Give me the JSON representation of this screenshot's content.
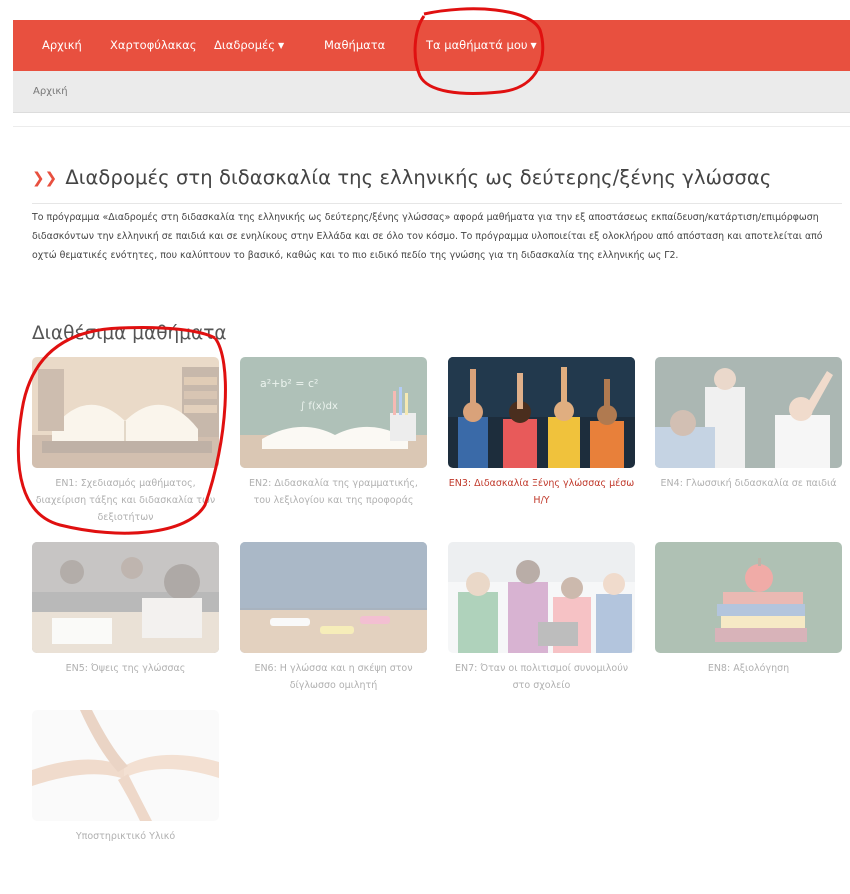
{
  "nav": {
    "items": [
      {
        "label": "Αρχική"
      },
      {
        "label": "Χαρτοφύλακας"
      },
      {
        "label": "Διαδρομές",
        "dropdown": true
      },
      {
        "label": "Μαθήματα"
      },
      {
        "label": "Τα μαθήματά μου",
        "dropdown": true
      }
    ],
    "caret": "▼"
  },
  "breadcrumb": {
    "label": "Αρχική"
  },
  "page": {
    "chevron": "❯❯",
    "title": "Διαδρομές στη διδασκαλία της ελληνικής ως δεύτερης/ξένης γλώσσας",
    "description": "Το πρόγραμμα «Διαδρομές στη διδασκαλία της ελληνικής ως δεύτερης/ξένης γλώσσας» αφορά μαθήματα για την εξ αποστάσεως εκπαίδευση/κατάρτιση/επιμόρφωση διδασκόντων την ελληνική σε παιδιά και σε ενηλίκους στην Ελλάδα και σε όλο τον κόσμο. Το πρόγραμμα υλοποιείται εξ ολοκλήρου από απόσταση και αποτελείται από οχτώ θεματικές ενότητες, που καλύπτουν το βασικό, καθώς και το πιο ειδικό πεδίο της γνώσης για τη διδασκαλία της ελληνικής ως Γ2.",
    "section_title": "Διαθέσιμα μαθήματα"
  },
  "courses": [
    {
      "label": "ΕΝ1: Σχεδιασμός μαθήματος, διαχείριση τάξης και διδασκαλία των δεξιοτήτων",
      "image": "books-on-table",
      "active": false
    },
    {
      "label": "ΕΝ2: Διδασκαλία της γραμματικής, του λεξιλογίου και της προφοράς",
      "image": "book-and-chalkboard",
      "active": false
    },
    {
      "label": "ΕΝ3: Διδασκαλία Ξένης γλώσσας μέσω Η/Υ",
      "image": "raised-hands-classroom",
      "active": true
    },
    {
      "label": "ΕΝ4: Γλωσσική διδασκαλία σε παιδιά",
      "image": "teacher-with-pupils",
      "active": false
    },
    {
      "label": "ΕΝ5: Όψεις της γλώσσας",
      "image": "students-writing",
      "active": false
    },
    {
      "label": "ΕΝ6: Η γλώσσα και η σκέψη στον δίγλωσσο ομιλητή",
      "image": "desk-with-chalk",
      "active": false
    },
    {
      "label": "ΕΝ7: Όταν οι πολιτισμοί συνομιλούν στο σχολείο",
      "image": "children-with-tablet",
      "active": false
    },
    {
      "label": "ΕΝ8: Αξιολόγηση",
      "image": "apple-on-books",
      "active": false
    },
    {
      "label": "Υποστηρικτικό Υλικό",
      "image": "joined-hands",
      "active": false
    }
  ],
  "colors": {
    "nav_bg": "#e8503f",
    "active_caption": "#c0392b",
    "annotation": "#e01010"
  }
}
